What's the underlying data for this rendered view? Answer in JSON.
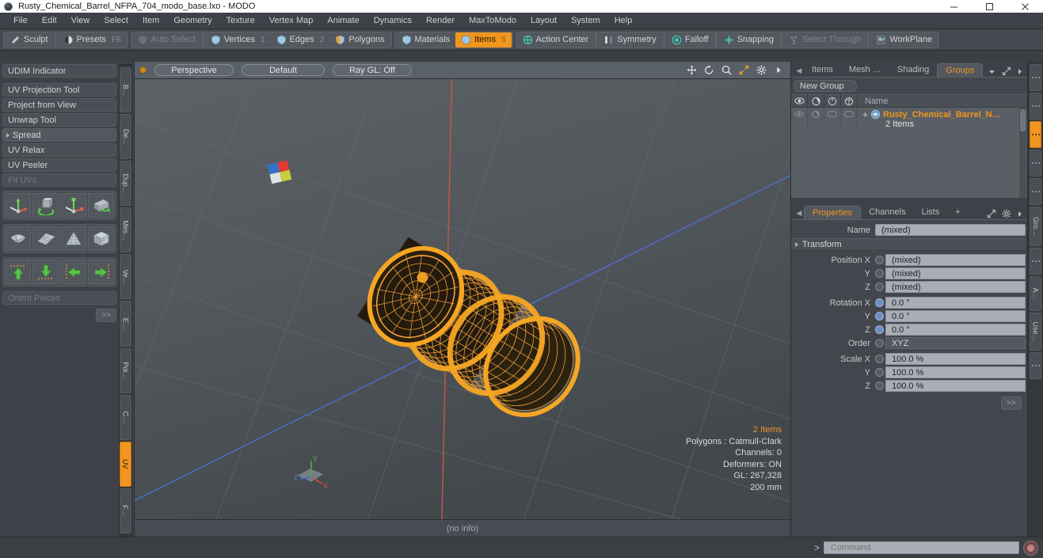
{
  "window": {
    "title": "Rusty_Chemical_Barrel_NFPA_704_modo_base.lxo - MODO",
    "minimize_label": "—",
    "maximize_label": "□",
    "close_label": "✕"
  },
  "menubar": {
    "items": [
      {
        "label": "File"
      },
      {
        "label": "Edit"
      },
      {
        "label": "View"
      },
      {
        "label": "Select"
      },
      {
        "label": "Item"
      },
      {
        "label": "Geometry"
      },
      {
        "label": "Texture"
      },
      {
        "label": "Vertex Map"
      },
      {
        "label": "Animate"
      },
      {
        "label": "Dynamics"
      },
      {
        "label": "Render"
      },
      {
        "label": "MaxToModo"
      },
      {
        "label": "Layout"
      },
      {
        "label": "System"
      },
      {
        "label": "Help"
      }
    ]
  },
  "toolbar": {
    "sculpt_label": "Sculpt",
    "presets_label": "Presets",
    "presets_key": "F6",
    "auto_select_label": "Auto Select",
    "vertices_label": "Vertices",
    "vertices_num": "1",
    "edges_label": "Edges",
    "edges_num": "2",
    "polygons_label": "Polygons",
    "materials_label": "Materials",
    "items_label": "Items",
    "items_num": "5",
    "action_center_label": "Action Center",
    "symmetry_label": "Symmetry",
    "falloff_label": "Falloff",
    "snapping_label": "Snapping",
    "select_through_label": "Select Through",
    "workplane_label": "WorkPlane"
  },
  "left_panel": {
    "udim_label": "UDIM Indicator",
    "tools": [
      {
        "label": "UV Projection Tool"
      },
      {
        "label": "Project from View"
      },
      {
        "label": "Unwrap Tool"
      }
    ],
    "spread_label": "Spread",
    "relax_tools": [
      {
        "label": "UV Relax",
        "dim": false
      },
      {
        "label": "UV Peeler",
        "dim": false
      },
      {
        "label": "Fit UVs",
        "dim": true
      }
    ],
    "icon_rows": [
      [
        "uv-move-tool-icon",
        "uv-rotate-tool-icon",
        "uv-scale-tool-icon",
        "uv-flip-tool-icon"
      ],
      [
        "uv-sphere-map-icon",
        "uv-planar-map-icon",
        "uv-cone-map-icon",
        "uv-box-map-icon"
      ],
      [
        "uv-align-up-icon",
        "uv-align-down-icon",
        "uv-align-left-icon",
        "uv-align-right-icon"
      ]
    ],
    "orient_pieces_label": "Orient Pieces",
    "more_label": ">>",
    "vtabs": [
      {
        "label": "B…",
        "active": false
      },
      {
        "label": "De…",
        "active": false
      },
      {
        "label": "Dup…",
        "active": false
      },
      {
        "label": "Mes…",
        "active": false
      },
      {
        "label": "Ve…",
        "active": false
      },
      {
        "label": "E…",
        "active": false
      },
      {
        "label": "Pol…",
        "active": false
      },
      {
        "label": "C…",
        "active": false
      },
      {
        "label": "UV",
        "active": true
      },
      {
        "label": "F…",
        "active": false
      }
    ]
  },
  "viewport": {
    "view_mode": "Perspective",
    "shading_mode": "Default",
    "raygl_mode": "Ray GL: Off",
    "nav_icons": [
      "pan-icon",
      "rotate-icon",
      "zoom-icon",
      "fit-icon",
      "gear-icon",
      "chevron-right-icon"
    ],
    "stats": [
      {
        "text": "2 Items",
        "highlight": true
      },
      {
        "text": "Polygons : Catmull-Clark",
        "highlight": false
      },
      {
        "text": "Channels: 0",
        "highlight": false
      },
      {
        "text": "Deformers: ON",
        "highlight": false
      },
      {
        "text": "GL: 267,328",
        "highlight": false
      },
      {
        "text": "200 mm",
        "highlight": false
      }
    ],
    "axis_labels": {
      "x": "X",
      "y": "Y",
      "z": "Z"
    },
    "status_text": "(no info)"
  },
  "right_panel": {
    "top_tabs": [
      {
        "label": "Items",
        "active": false
      },
      {
        "label": "Mesh …",
        "active": false
      },
      {
        "label": "Shading",
        "active": false
      },
      {
        "label": "Groups",
        "active": true
      }
    ],
    "new_group_label": "New Group",
    "tree_columns": [
      "visibility-eye-icon",
      "render-icon",
      "lock-icon",
      "wireframe-icon"
    ],
    "tree_name_header": "Name",
    "tree_rows": [
      {
        "name": "Rusty_Chemical_Barrel_N…",
        "sub": "2 Items"
      }
    ],
    "bottom_tabs": [
      {
        "label": "Properties",
        "active": true
      },
      {
        "label": "Channels",
        "active": false
      },
      {
        "label": "Lists",
        "active": false
      },
      {
        "label": "+",
        "active": false
      }
    ],
    "name_label": "Name",
    "name_value": "(mixed)",
    "transform_label": "Transform",
    "transform_rows": [
      {
        "label": "Position X",
        "value": "(mixed)",
        "on": false,
        "type": "number"
      },
      {
        "label": "Y",
        "value": "(mixed)",
        "on": false,
        "type": "number"
      },
      {
        "label": "Z",
        "value": "(mixed)",
        "on": false,
        "type": "number"
      },
      {
        "label": "Rotation X",
        "value": "0.0 °",
        "on": true,
        "type": "number"
      },
      {
        "label": "Y",
        "value": "0.0 °",
        "on": true,
        "type": "number"
      },
      {
        "label": "Z",
        "value": "0.0 °",
        "on": true,
        "type": "number"
      },
      {
        "label": "Order",
        "value": "XYZ",
        "on": false,
        "type": "dropdown"
      },
      {
        "label": "Scale X",
        "value": "100.0 %",
        "on": false,
        "type": "number"
      },
      {
        "label": "Y",
        "value": "100.0 %",
        "on": false,
        "type": "number"
      },
      {
        "label": "Z",
        "value": "100.0 %",
        "on": false,
        "type": "number"
      }
    ],
    "more_label": ">>",
    "rtabs": [
      {
        "label": "",
        "active": false
      },
      {
        "label": "",
        "active": false
      },
      {
        "label": "",
        "active": true
      },
      {
        "label": "",
        "active": false
      },
      {
        "label": "",
        "active": false
      },
      {
        "label": "Gro…",
        "active": false
      },
      {
        "label": "",
        "active": false
      },
      {
        "label": "A…",
        "active": false
      },
      {
        "label": "Use…",
        "active": false
      },
      {
        "label": "",
        "active": false
      }
    ]
  },
  "command_bar": {
    "prompt": "&gt;",
    "placeholder": "Command",
    "record_icon": "record-icon"
  },
  "colors": {
    "accent": "#f0951f",
    "selection_wire": "#f5a623",
    "viewport_bg": "#53585d",
    "panel_bg": "#3e4248"
  }
}
